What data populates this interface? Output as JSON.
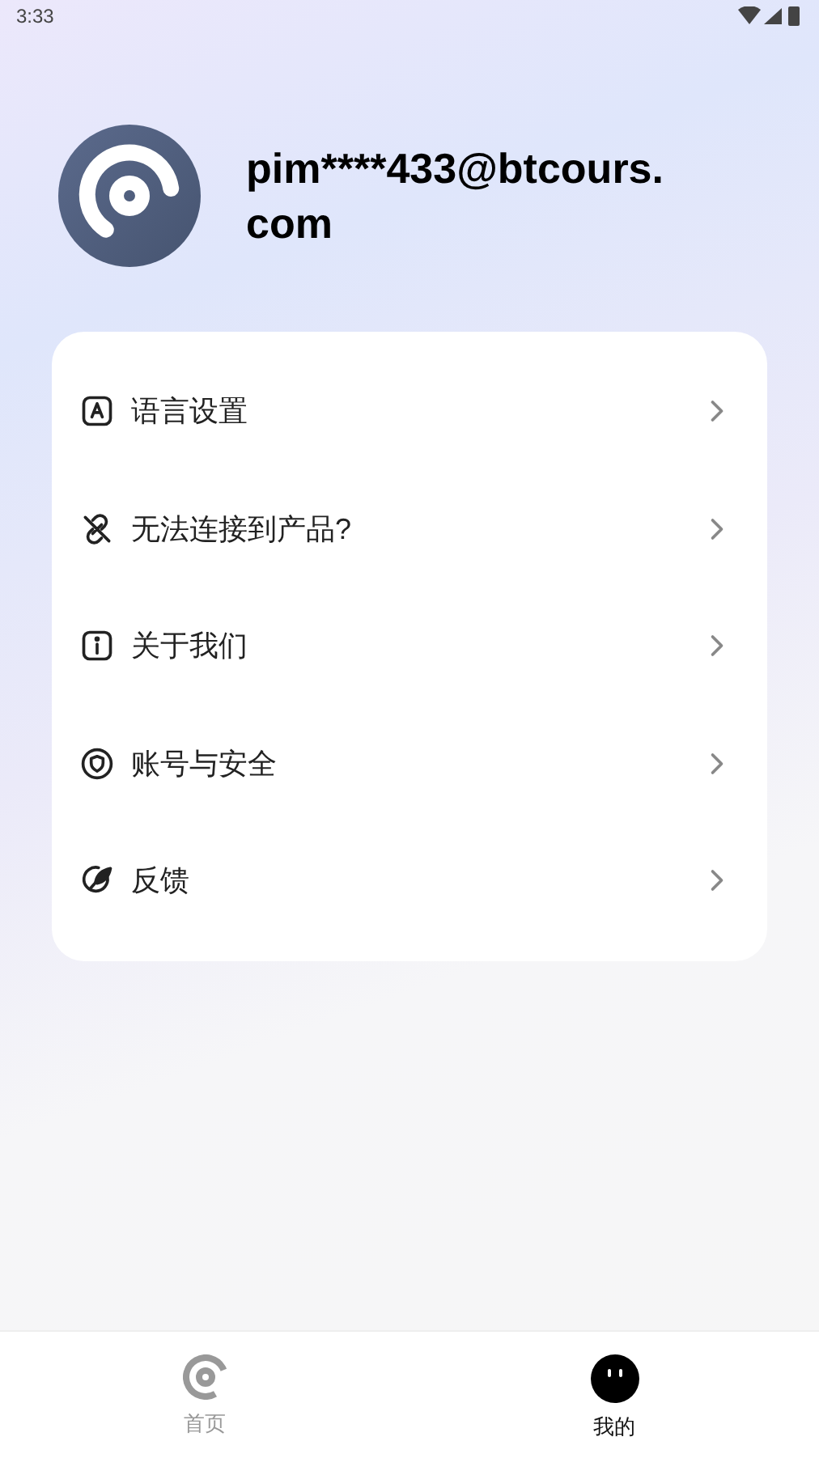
{
  "status_bar": {
    "time": "3:33"
  },
  "profile": {
    "email": "pim****433@btcours.com"
  },
  "menu": [
    {
      "kind": "language",
      "label": "语言设置"
    },
    {
      "kind": "link",
      "label": "无法连接到产品?"
    },
    {
      "kind": "info",
      "label": "关于我们"
    },
    {
      "kind": "security",
      "label": "账号与安全"
    },
    {
      "kind": "feedback",
      "label": "反馈"
    }
  ],
  "bottom_nav": [
    {
      "kind": "home",
      "label": "首页",
      "selected": false
    },
    {
      "kind": "me",
      "label": "我的",
      "selected": true
    }
  ]
}
